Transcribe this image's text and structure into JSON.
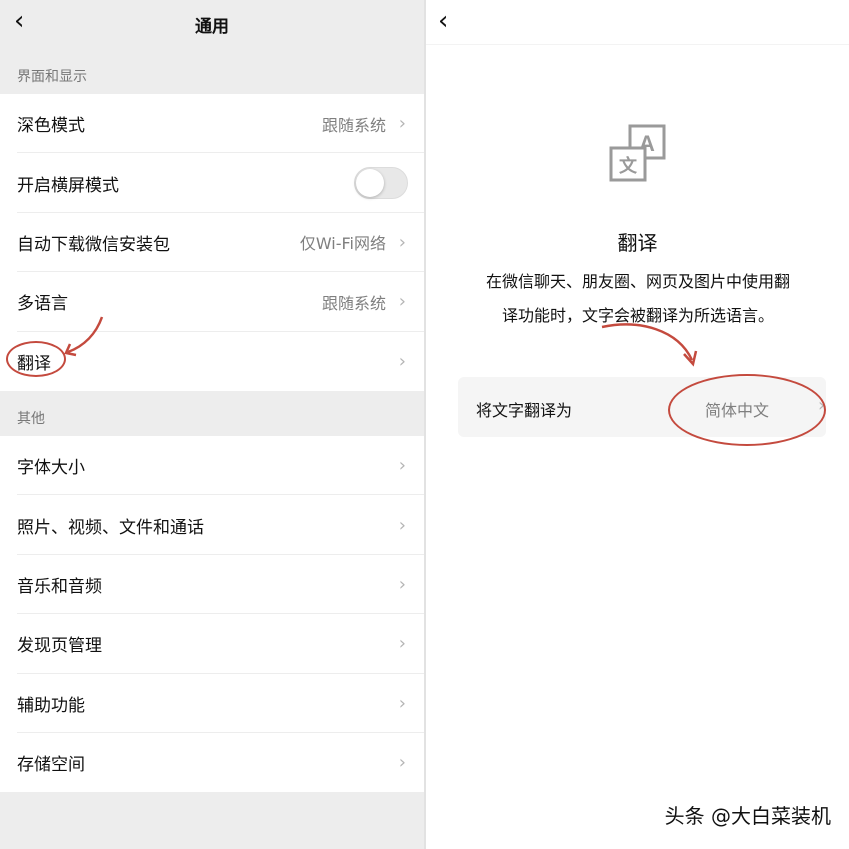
{
  "left": {
    "back_icon": "chevron-left-icon",
    "title": "通用",
    "section1_label": "界面和显示",
    "section1_items": [
      {
        "label": "深色模式",
        "value": "跟随系统"
      },
      {
        "label": "开启横屏模式",
        "toggle": false
      },
      {
        "label": "自动下载微信安装包",
        "value": "仅Wi-Fi网络"
      },
      {
        "label": "多语言",
        "value": "跟随系统"
      },
      {
        "label": "翻译",
        "value": ""
      }
    ],
    "section2_label": "其他",
    "section2_items": [
      {
        "label": "字体大小"
      },
      {
        "label": "照片、视频、文件和通话"
      },
      {
        "label": "音乐和音频"
      },
      {
        "label": "发现页管理"
      },
      {
        "label": "辅助功能"
      },
      {
        "label": "存储空间"
      }
    ]
  },
  "right": {
    "back_icon": "chevron-left-icon",
    "icon": "translate-icon",
    "icon_glyph_front": "文",
    "icon_glyph_back": "A",
    "title": "翻译",
    "desc_line1": "在微信聊天、朋友圈、网页及图片中使用翻",
    "desc_line2": "译功能时，文字会被翻译为所选语言。",
    "setting_label": "将文字翻译为",
    "setting_value": "简体中文"
  },
  "chevron": "›",
  "watermark": "头条 @大白菜装机",
  "colors": {
    "annotation": "#c44a3e",
    "background_grey": "#ededed",
    "secondary_text": "#7f7f7f"
  }
}
